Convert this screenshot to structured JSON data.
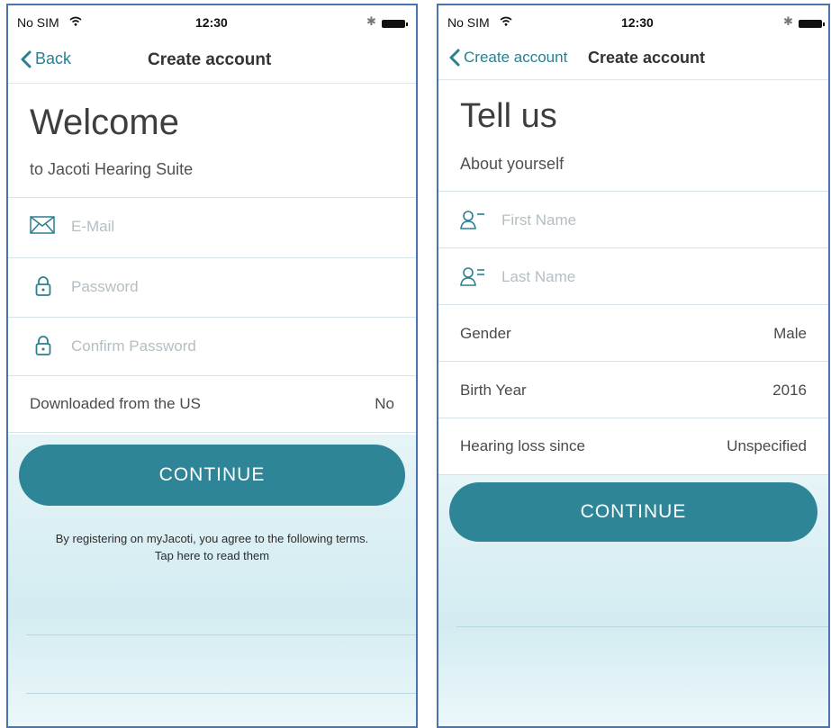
{
  "status_bar": {
    "carrier": "No SIM",
    "time": "12:30",
    "bluetooth": "bluetooth-icon",
    "battery": "battery-icon"
  },
  "left": {
    "nav": {
      "back_label": "Back",
      "title": "Create account"
    },
    "heading": "Welcome",
    "subheading": "to Jacoti Hearing Suite",
    "email_placeholder": "E-Mail",
    "password_placeholder": "Password",
    "confirm_password_placeholder": "Confirm Password",
    "downloaded_label": "Downloaded from the US",
    "downloaded_value": "No",
    "continue_label": "CONTINUE",
    "terms_line1": "By registering on myJacoti, you agree to the following terms.",
    "terms_line2": "Tap here to read them"
  },
  "right": {
    "nav": {
      "back_label": "Create account",
      "title": "Create account"
    },
    "heading": "Tell us",
    "subheading": "About yourself",
    "first_name_placeholder": "First Name",
    "last_name_placeholder": "Last Name",
    "gender_label": "Gender",
    "gender_value": "Male",
    "birth_year_label": "Birth Year",
    "birth_year_value": "2016",
    "hearing_loss_label": "Hearing loss since",
    "hearing_loss_value": "Unspecified",
    "continue_label": "CONTINUE"
  },
  "colors": {
    "accent": "#2d8597",
    "frame": "#4a74b0",
    "background_tint": "#d3ecf1"
  }
}
